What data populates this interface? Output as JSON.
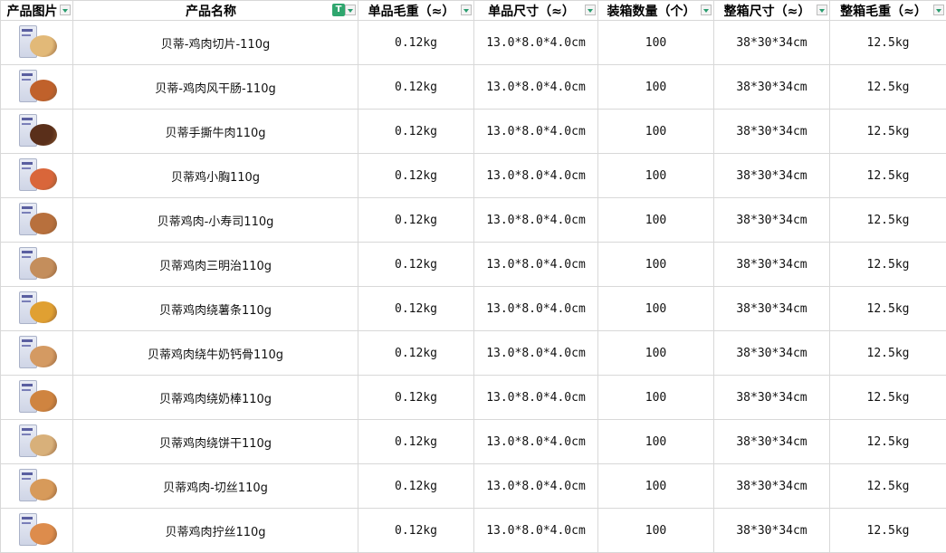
{
  "headers": {
    "image": "产品图片",
    "name": "产品名称",
    "unit_weight": "单品毛重（≈）",
    "unit_size": "单品尺寸（≈）",
    "pack_qty": "装箱数量（个）",
    "box_size": "整箱尺寸（≈）",
    "box_weight": "整箱毛重（≈）"
  },
  "rows": [
    {
      "name": "贝蒂-鸡肉切片-110g",
      "unit_weight": "0.12kg",
      "unit_size": "13.0*8.0*4.0cm",
      "pack_qty": "100",
      "box_size": "38*30*34cm",
      "box_weight": "12.5kg",
      "food_color": "#e2b978"
    },
    {
      "name": "贝蒂-鸡肉风干肠-110g",
      "unit_weight": "0.12kg",
      "unit_size": "13.0*8.0*4.0cm",
      "pack_qty": "100",
      "box_size": "38*30*34cm",
      "box_weight": "12.5kg",
      "food_color": "#c0612b"
    },
    {
      "name": "贝蒂手撕牛肉110g",
      "unit_weight": "0.12kg",
      "unit_size": "13.0*8.0*4.0cm",
      "pack_qty": "100",
      "box_size": "38*30*34cm",
      "box_weight": "12.5kg",
      "food_color": "#5a2f1a"
    },
    {
      "name": "贝蒂鸡小胸110g",
      "unit_weight": "0.12kg",
      "unit_size": "13.0*8.0*4.0cm",
      "pack_qty": "100",
      "box_size": "38*30*34cm",
      "box_weight": "12.5kg",
      "food_color": "#d9663a"
    },
    {
      "name": "贝蒂鸡肉-小寿司110g",
      "unit_weight": "0.12kg",
      "unit_size": "13.0*8.0*4.0cm",
      "pack_qty": "100",
      "box_size": "38*30*34cm",
      "box_weight": "12.5kg",
      "food_color": "#b8703d"
    },
    {
      "name": "贝蒂鸡肉三明治110g",
      "unit_weight": "0.12kg",
      "unit_size": "13.0*8.0*4.0cm",
      "pack_qty": "100",
      "box_size": "38*30*34cm",
      "box_weight": "12.5kg",
      "food_color": "#c48e5c"
    },
    {
      "name": "贝蒂鸡肉绕薯条110g",
      "unit_weight": "0.12kg",
      "unit_size": "13.0*8.0*4.0cm",
      "pack_qty": "100",
      "box_size": "38*30*34cm",
      "box_weight": "12.5kg",
      "food_color": "#e0a032"
    },
    {
      "name": "贝蒂鸡肉绕牛奶钙骨110g",
      "unit_weight": "0.12kg",
      "unit_size": "13.0*8.0*4.0cm",
      "pack_qty": "100",
      "box_size": "38*30*34cm",
      "box_weight": "12.5kg",
      "food_color": "#d49a62"
    },
    {
      "name": "贝蒂鸡肉绕奶棒110g",
      "unit_weight": "0.12kg",
      "unit_size": "13.0*8.0*4.0cm",
      "pack_qty": "100",
      "box_size": "38*30*34cm",
      "box_weight": "12.5kg",
      "food_color": "#cf8440"
    },
    {
      "name": "贝蒂鸡肉绕饼干110g",
      "unit_weight": "0.12kg",
      "unit_size": "13.0*8.0*4.0cm",
      "pack_qty": "100",
      "box_size": "38*30*34cm",
      "box_weight": "12.5kg",
      "food_color": "#d8b07a"
    },
    {
      "name": "贝蒂鸡肉-切丝110g",
      "unit_weight": "0.12kg",
      "unit_size": "13.0*8.0*4.0cm",
      "pack_qty": "100",
      "box_size": "38*30*34cm",
      "box_weight": "12.5kg",
      "food_color": "#d79a5a"
    },
    {
      "name": "贝蒂鸡肉拧丝110g",
      "unit_weight": "0.12kg",
      "unit_size": "13.0*8.0*4.0cm",
      "pack_qty": "100",
      "box_size": "38*30*34cm",
      "box_weight": "12.5kg",
      "food_color": "#dd8c4c"
    }
  ],
  "icons": {
    "filter": "dropdown-filter-icon",
    "text_type": "text-type-icon"
  },
  "colors": {
    "accent": "#2fa66e",
    "grid": "#d8d8d8"
  }
}
